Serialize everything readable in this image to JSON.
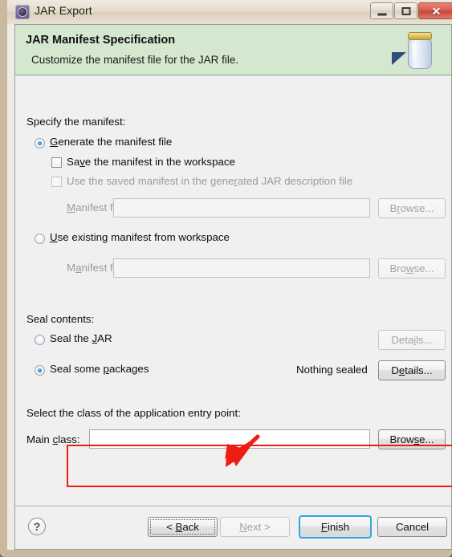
{
  "window": {
    "title": "JAR Export",
    "icon": "jar-export-icon",
    "controls": {
      "minimize": "minimize-button",
      "maximize": "restore-button",
      "close_label": "✕"
    }
  },
  "banner": {
    "title": "JAR Manifest Specification",
    "subtitle": "Customize the manifest file for the JAR file.",
    "icon": "jar-icon",
    "background_color": "#d3e8ce"
  },
  "manifest_section": {
    "group_label": "Specify the manifest:",
    "options": [
      {
        "label": "Generate the manifest file",
        "selected": true
      },
      {
        "label": "Use existing manifest from workspace",
        "selected": false
      }
    ],
    "checkboxes": [
      {
        "label": "Save the manifest in the workspace",
        "checked": false,
        "enabled": true
      },
      {
        "label": "Use the saved manifest in the generated JAR description file",
        "checked": false,
        "enabled": false
      }
    ],
    "manifest_file_label": "Manifest file:",
    "manifest_file_value": "",
    "browse_label": "Browse..."
  },
  "seal_section": {
    "group_label": "Seal contents:",
    "options": [
      {
        "label": "Seal the JAR",
        "selected": false
      },
      {
        "label": "Seal some packages",
        "selected": true
      }
    ],
    "status_text": "Nothing sealed",
    "details_label": "Details..."
  },
  "entry_point_section": {
    "group_label": "Select the class of the application entry point:",
    "main_class_label": "Main class:",
    "main_class_value": "",
    "browse_label": "Browse..."
  },
  "footer": {
    "help_label": "?",
    "buttons": [
      {
        "label": "< Back",
        "enabled": true,
        "state": "focused"
      },
      {
        "label": "Next >",
        "enabled": false,
        "state": "disabled"
      },
      {
        "label": "Finish",
        "enabled": true,
        "state": "default"
      },
      {
        "label": "Cancel",
        "enabled": true,
        "state": "normal"
      }
    ]
  },
  "annotation": {
    "color": "#ef1c13",
    "shapes": [
      "highlight-rectangle",
      "pointer-arrow"
    ]
  }
}
